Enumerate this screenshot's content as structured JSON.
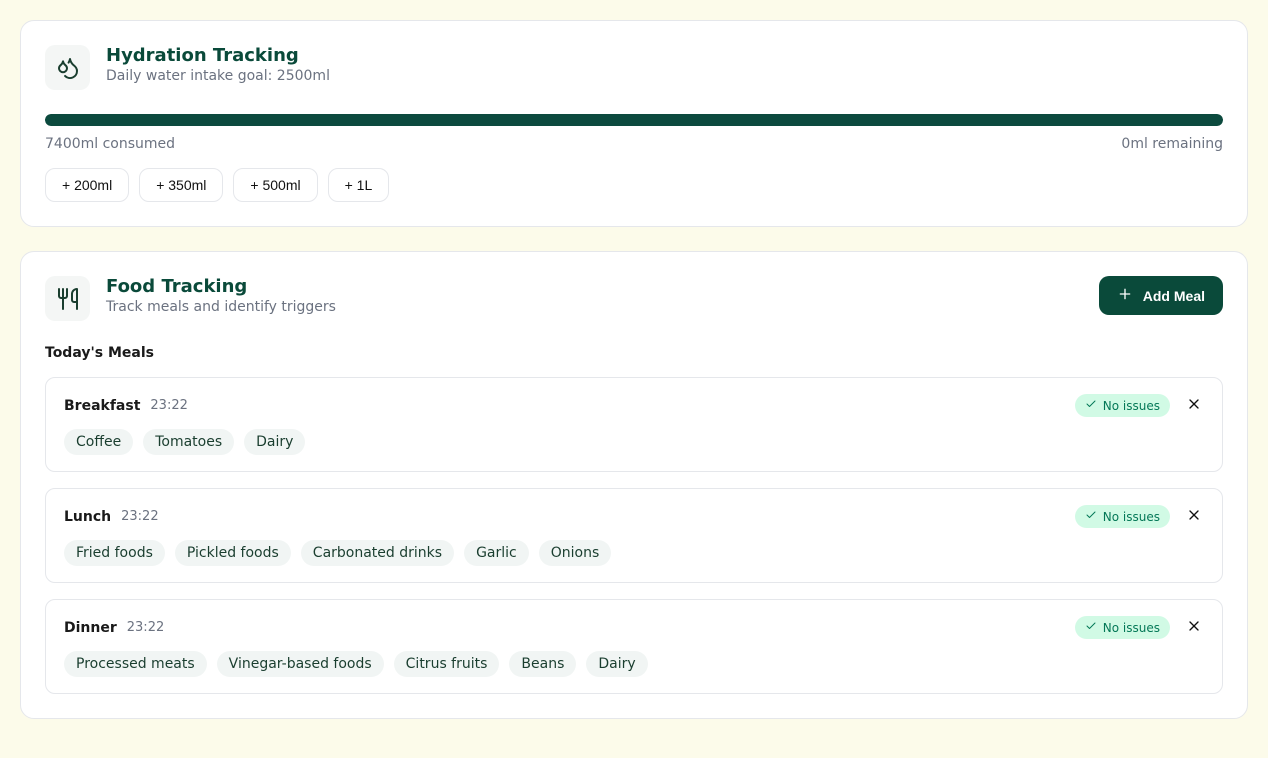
{
  "hydration": {
    "title": "Hydration Tracking",
    "subtitle": "Daily water intake goal: 2500ml",
    "consumed_label": "7400ml consumed",
    "remaining_label": "0ml remaining",
    "progress_percent": 100,
    "quick_add": [
      "+ 200ml",
      "+ 350ml",
      "+ 500ml",
      "+ 1L"
    ]
  },
  "food": {
    "title": "Food Tracking",
    "subtitle": "Track meals and identify triggers",
    "add_button": "Add Meal",
    "section_heading": "Today's Meals",
    "status_label": "No issues",
    "meals": [
      {
        "name": "Breakfast",
        "time": "23:22",
        "items": [
          "Coffee",
          "Tomatoes",
          "Dairy"
        ]
      },
      {
        "name": "Lunch",
        "time": "23:22",
        "items": [
          "Fried foods",
          "Pickled foods",
          "Carbonated drinks",
          "Garlic",
          "Onions"
        ]
      },
      {
        "name": "Dinner",
        "time": "23:22",
        "items": [
          "Processed meats",
          "Vinegar-based foods",
          "Citrus fruits",
          "Beans",
          "Dairy"
        ]
      }
    ]
  }
}
